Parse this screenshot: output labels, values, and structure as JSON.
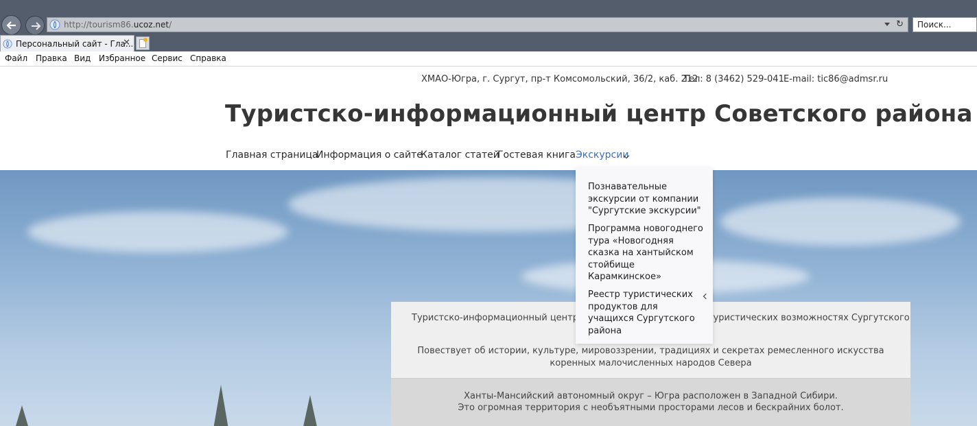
{
  "browser": {
    "url_prefix": "http://tourism86.",
    "url_domain": "ucoz.net",
    "url_suffix": "/",
    "search_placeholder": "Поиск...",
    "tab_title": "Персональный сайт - Гла...",
    "tab_close": "✕",
    "refresh": "↻"
  },
  "menu_bar": {
    "items": [
      "Файл",
      "Правка",
      "Вид",
      "Избранное",
      "Сервис",
      "Справка"
    ]
  },
  "header": {
    "address": "ХМАО-Югра, г. Сургут, пр-т Комсомольский, 36/2, каб. 212",
    "phone": "Тел: 8 (3462) 529-041",
    "email": "E-mail: tic86@admsr.ru",
    "site_title": "Туристско-информационный центр Советского района"
  },
  "nav": {
    "items": [
      "Главная страница",
      "Информация о сайте",
      "Каталог статей",
      "Гостевая книга",
      "Экскурсии"
    ]
  },
  "dropdown": {
    "items": [
      "Познавательные экскурсии от компании \"Сургутские экскурсии\"",
      "Программа новогоднего тура «Новогодняя сказка на хантыйском стойбище Карамкинское»",
      "Реестр туристических продуктов для учащихся Сургутского района"
    ]
  },
  "content": {
    "line1_left": "Туристско-информационный центр ра",
    "line1_right": "туристических возможностях Сургутского",
    "line2": "Повествует об истории, культуре, мировоззрении, традициях и секретах ремесленного искусства коренных малочисленных народов Севера",
    "line3": "Ханты-Мансийский автономный округ – Югра расположен в Западной Сибири.",
    "line4": "Это огромная территория с необъятными просторами лесов и бескрайних болот."
  },
  "colors": {
    "chrome": "#545d6b",
    "nav_active": "#3d6fb3",
    "title": "#363636"
  }
}
